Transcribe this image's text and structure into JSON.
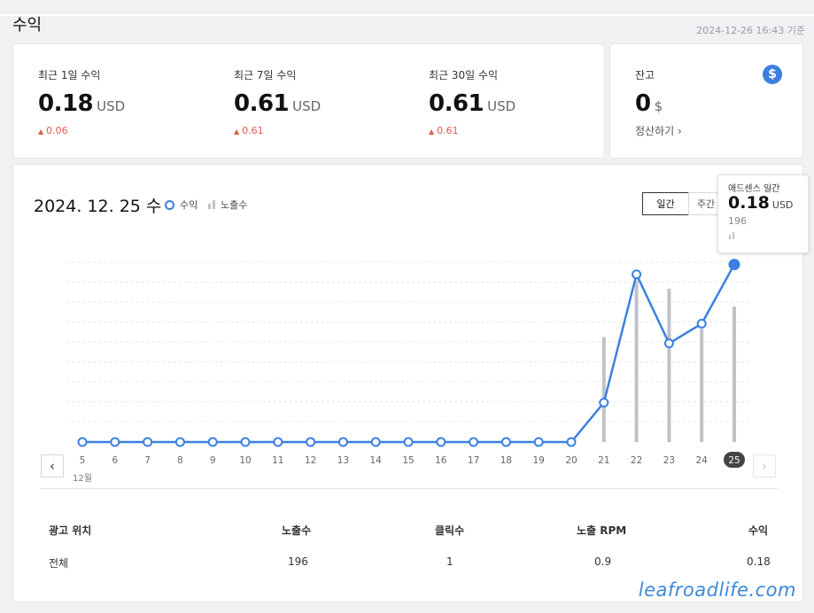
{
  "header": {
    "title": "수익",
    "as_of": "2024-12-26 16:43 기준"
  },
  "summary": [
    {
      "label": "최근 1일 수익",
      "value": "0.18",
      "unit": "USD",
      "delta": "0.06"
    },
    {
      "label": "최근 7일 수익",
      "value": "0.61",
      "unit": "USD",
      "delta": "0.61"
    },
    {
      "label": "최근 30일 수익",
      "value": "0.61",
      "unit": "USD",
      "delta": "0.61"
    }
  ],
  "balance": {
    "label": "잔고",
    "value": "0",
    "unit": "$",
    "badge": "$",
    "settle_label": "정산하기 ›"
  },
  "chart_panel": {
    "date_title": "2024. 12. 25 수",
    "legend_revenue": "수익",
    "legend_impressions": "노출수",
    "tab_daily": "일간",
    "tab_weekly": "주간",
    "month_label": "12월",
    "prev_icon": "‹",
    "next_icon": "›"
  },
  "tooltip": {
    "title": "애드센스 일간",
    "value": "0.18",
    "unit": "USD",
    "impressions": "196"
  },
  "chart_data": {
    "type": "line",
    "x": [
      "5",
      "6",
      "7",
      "8",
      "9",
      "10",
      "11",
      "12",
      "13",
      "14",
      "15",
      "16",
      "17",
      "18",
      "19",
      "20",
      "21",
      "22",
      "23",
      "24",
      "25"
    ],
    "series": [
      {
        "name": "수익",
        "values": [
          0,
          0,
          0,
          0,
          0,
          0,
          0,
          0,
          0,
          0,
          0,
          0,
          0,
          0,
          0,
          0,
          0.04,
          0.17,
          0.1,
          0.12,
          0.18
        ],
        "color": "#3d7fe0"
      },
      {
        "name": "노출수",
        "values": [
          0,
          0,
          0,
          0,
          0,
          0,
          0,
          0,
          0,
          0,
          0,
          0,
          0,
          0,
          0,
          0,
          130,
          200,
          190,
          140,
          168
        ],
        "color": "#bfc3c9"
      }
    ],
    "selected_x": "25",
    "grid": true
  },
  "table": {
    "headers": [
      "광고 위치",
      "노출수",
      "클릭수",
      "노출 RPM",
      "수익"
    ],
    "rows": [
      [
        "전체",
        "196",
        "1",
        "0.9",
        "0.18"
      ]
    ]
  },
  "watermark": "leafroadlife.com",
  "colors": {
    "accent": "#3d7fe0",
    "delta_up": "#e35a4a",
    "bar": "#bfc3c9"
  }
}
